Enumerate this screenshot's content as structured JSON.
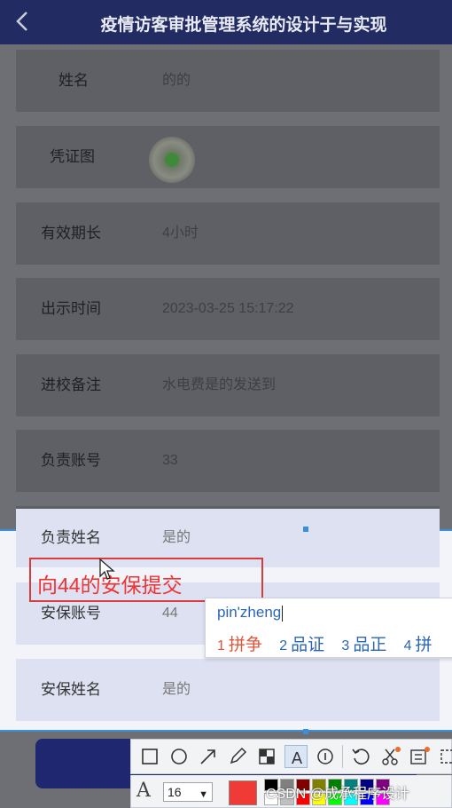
{
  "header": {
    "title": "疫情访客审批管理系统的设计于与实现"
  },
  "fields": [
    {
      "label": "姓名",
      "value": "的的"
    },
    {
      "label": "凭证图",
      "value": ""
    },
    {
      "label": "有效期长",
      "value": "4小时"
    },
    {
      "label": "出示时间",
      "value": "2023-03-25 15:17:22"
    },
    {
      "label": "进校备注",
      "value": "水电费是的发送到"
    },
    {
      "label": "负责账号",
      "value": "33"
    },
    {
      "label": "负责姓名",
      "value": "是的"
    },
    {
      "label": "安保账号",
      "value": "44"
    },
    {
      "label": "安保姓名",
      "value": "是的"
    }
  ],
  "annotation": {
    "text": "向44的安保提交",
    "color": "#e33333"
  },
  "ime": {
    "pinyin": "pin'zheng",
    "candidates": [
      {
        "num": "1",
        "text": "拼争"
      },
      {
        "num": "2",
        "text": "品证"
      },
      {
        "num": "3",
        "text": "品正"
      },
      {
        "num": "4",
        "text": "拼"
      }
    ]
  },
  "toolbar": {
    "tools": [
      "rectangle-icon",
      "ellipse-icon",
      "arrow-icon",
      "pencil-icon",
      "mosaic-icon",
      "text-icon",
      "number-icon",
      "undo-icon",
      "cut-icon",
      "ocr-icon",
      "more-icon"
    ],
    "active_tool": "text-icon",
    "font_size": "16",
    "current_color": "#f03a35"
  },
  "watermark": "CSDN @成承程序设计"
}
